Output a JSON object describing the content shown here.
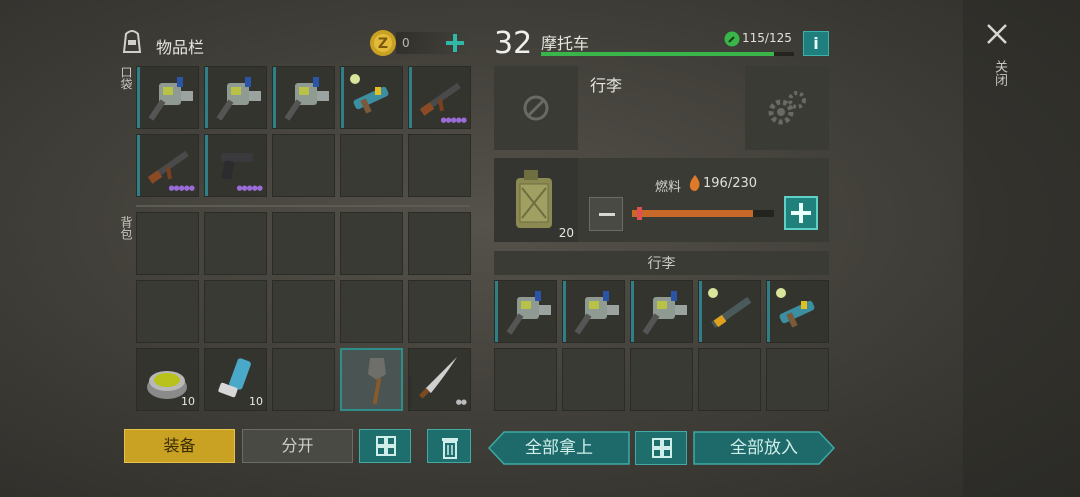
{
  "header": {
    "inventory_title": "物品栏",
    "coin_count": "0",
    "vehicle_level": "32",
    "vehicle_name": "摩托车",
    "durability": "115/125",
    "durability_fraction": 0.92,
    "info_button": "i"
  },
  "close": {
    "label": "关闭"
  },
  "inventory": {
    "pocket_label": "口袋",
    "backpack_label": "背包",
    "pocket": [
      {
        "item": "gun-flamethrower-icon",
        "dots": ""
      },
      {
        "item": "gun-flamethrower-icon",
        "dots": ""
      },
      {
        "item": "gun-flamethrower-icon",
        "dots": ""
      },
      {
        "item": "gun-blaster-icon",
        "dots": ""
      },
      {
        "item": "rifle-ak-icon",
        "dots": "●●●●●"
      },
      {
        "item": "rifle-ak-icon",
        "dots": "●●●●●"
      },
      {
        "item": "pistol-icon",
        "dots": "●●●●●"
      }
    ],
    "backpack_items": [
      {
        "item": "jar-icon",
        "count": "10"
      },
      {
        "item": "inhaler-icon",
        "count": "10"
      },
      {
        "item": "shovel-icon",
        "count": ""
      },
      {
        "item": "machete-icon",
        "count": "",
        "dots": "●●"
      }
    ]
  },
  "vehicle": {
    "luggage_title": "行李",
    "fuel_label": "燃料",
    "fuel_value": "196/230",
    "fuel_fraction": 0.85,
    "jerrycan_count": "20",
    "luggage_section": "行李",
    "luggage_items": [
      "gun-flamethrower-icon",
      "gun-flamethrower-icon",
      "gun-flamethrower-icon",
      "rifle-laser-icon",
      "gun-blaster-icon"
    ]
  },
  "buttons": {
    "equip": "装备",
    "split": "分开",
    "take_all": "全部拿上",
    "put_all": "全部放入"
  },
  "colors": {
    "accent_teal": "#2e8f8a",
    "gold": "#c9a224",
    "durability_green": "#39b54a",
    "fuel_orange": "#c8692a"
  }
}
